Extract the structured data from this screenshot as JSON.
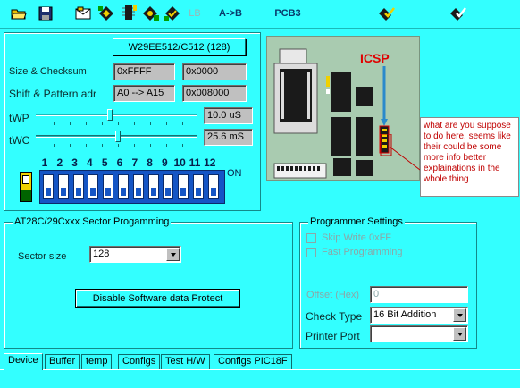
{
  "toolbar": {
    "items": [
      {
        "name": "open-icon"
      },
      {
        "name": "save-icon"
      },
      {
        "name": "mail-icon"
      },
      {
        "name": "chip-read-icon"
      },
      {
        "name": "chip-info-icon"
      },
      {
        "name": "chip-program-icon"
      },
      {
        "name": "chip-verify-icon"
      },
      {
        "name": "chip-auto-icon"
      }
    ],
    "lb_label": "LB",
    "ab_label": "A->B",
    "pcb_label": "PCB3",
    "right_icons": [
      "chip-check-icon",
      "chip-erase-icon"
    ]
  },
  "device": {
    "chip_button": "W29EE512/C512   (128)",
    "size_label": "Size & Checksum",
    "size_value": "0xFFFF",
    "checksum_value": "0x0000",
    "shift_label": "Shift & Pattern adr",
    "shift_value": "A0 --> A15",
    "pattern_value": "0x008000",
    "twp_label": "tWP",
    "twp_value": "10.0 uS",
    "twp_level": 0.46,
    "twc_label": "tWC",
    "twc_value": "25.6 mS",
    "twc_level": 0.51
  },
  "dip": {
    "numbers": [
      "1",
      "2",
      "3",
      "4",
      "5",
      "6",
      "7",
      "8",
      "9",
      "10",
      "11",
      "12"
    ],
    "on_label": "ON",
    "states": [
      false,
      false,
      false,
      false,
      false,
      false,
      false,
      false,
      false,
      false,
      false,
      false
    ]
  },
  "board": {
    "icsp_label": "ICSP"
  },
  "annotation": {
    "text": "what are you suppose to do here. seems like their could be some more info better explainations in the whole thing",
    "color": "#c00000"
  },
  "sector": {
    "title": "AT28C/29Cxxx Sector Progamming",
    "size_label": "Sector size",
    "size_value": "128",
    "protect_button": "Disable Software data Protect"
  },
  "programmer": {
    "title": "Programmer Settings",
    "skip_write": "Skip Write 0xFF",
    "fast_programming": "Fast Programming",
    "offset_label": "Offset (Hex)",
    "offset_value": "0",
    "check_type_label": "Check Type",
    "check_type_value": "16 Bit Addition",
    "printer_port_label": "Printer Port",
    "printer_port_value": ""
  },
  "tabs": [
    {
      "label": "Device",
      "active": true
    },
    {
      "label": "Buffer",
      "active": false
    },
    {
      "label": "temp",
      "active": false
    },
    {
      "label": "Configs",
      "active": false
    },
    {
      "label": "Test H/W",
      "active": false
    },
    {
      "label": "Configs PIC18F",
      "active": false
    }
  ]
}
